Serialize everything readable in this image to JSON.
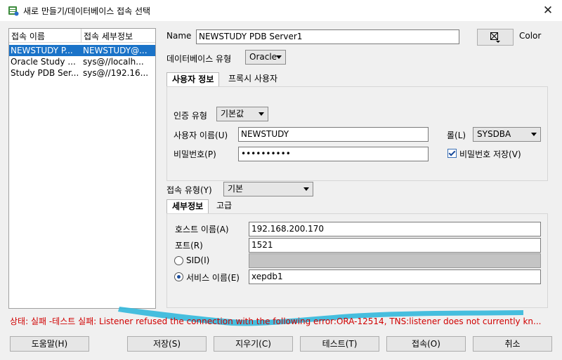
{
  "window": {
    "title": "새로 만들기/데이터베이스 접속 선택",
    "close_glyph": "✕"
  },
  "connections": {
    "headers": [
      "접속 이름",
      "접속 세부정보"
    ],
    "rows": [
      {
        "name": "NEWSTUDY P...",
        "details": "NEWSTUDY@...",
        "selected": true
      },
      {
        "name": "Oracle Study ...",
        "details": "sys@//localh..."
      },
      {
        "name": "Study PDB Ser...",
        "details": "sys@//192.16..."
      }
    ]
  },
  "form": {
    "name_label": "Name",
    "name_value": "NEWSTUDY PDB Server1",
    "color_label": "Color",
    "db_type_label": "데이터베이스 유형",
    "db_type_value": "Oracle",
    "tabs": [
      "사용자 정보",
      "프록시 사용자"
    ],
    "auth_type_label": "인증 유형",
    "auth_type_value": "기본값",
    "username_label": "사용자 이름(U)",
    "username_value": "NEWSTUDY",
    "role_label": "롤(L)",
    "role_value": "SYSDBA",
    "password_label": "비밀번호(P)",
    "password_value": "••••••••••",
    "save_password_label": "비밀번호 저장(V)",
    "save_password_checked": true,
    "conn_type_label": "접속 유형(Y)",
    "conn_type_value": "기본",
    "detail_tabs": [
      "세부정보",
      "고급"
    ],
    "host_label": "호스트 이름(A)",
    "host_value": "192.168.200.170",
    "port_label": "포트(R)",
    "port_value": "1521",
    "sid_label": "SID(I)",
    "sid_value": "",
    "service_label": "서비스 이름(E)",
    "service_value": "xepdb1",
    "selected_option": "service"
  },
  "status": {
    "text": "상태: 실패 -테스트 실패: Listener refused the connection with the following error:ORA-12514, TNS:listener does not currently kn...",
    "color": "#d00000",
    "highlight_color": "#33b8dc"
  },
  "buttons": {
    "help": "도움말(H)",
    "save": "저장(S)",
    "clear": "지우기(C)",
    "test": "테스트(T)",
    "connect": "접속(O)",
    "cancel": "취소"
  }
}
